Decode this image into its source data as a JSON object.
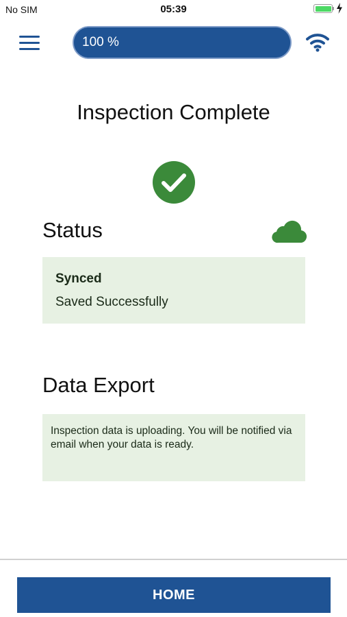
{
  "status_bar": {
    "carrier": "No SIM",
    "time": "05:39",
    "battery_level": 1.0
  },
  "toolbar": {
    "menu_icon": "hamburger-menu-icon",
    "progress": {
      "text": "100 %",
      "value": 100
    },
    "wifi_icon": "wifi-icon"
  },
  "page": {
    "title": "Inspection Complete",
    "check_icon": "check-circle-icon"
  },
  "status_section": {
    "title": "Status",
    "cloud_icon": "cloud-icon",
    "head": "Synced",
    "body": "Saved Successfully"
  },
  "export_section": {
    "title": "Data Export",
    "text": "Inspection data is uploading. You will be notified via email when your data is ready."
  },
  "footer": {
    "home_label": "HOME"
  },
  "colors": {
    "primary": "#1f5394",
    "success": "#3b8a3a",
    "panel_bg": "#e7f1e3"
  }
}
